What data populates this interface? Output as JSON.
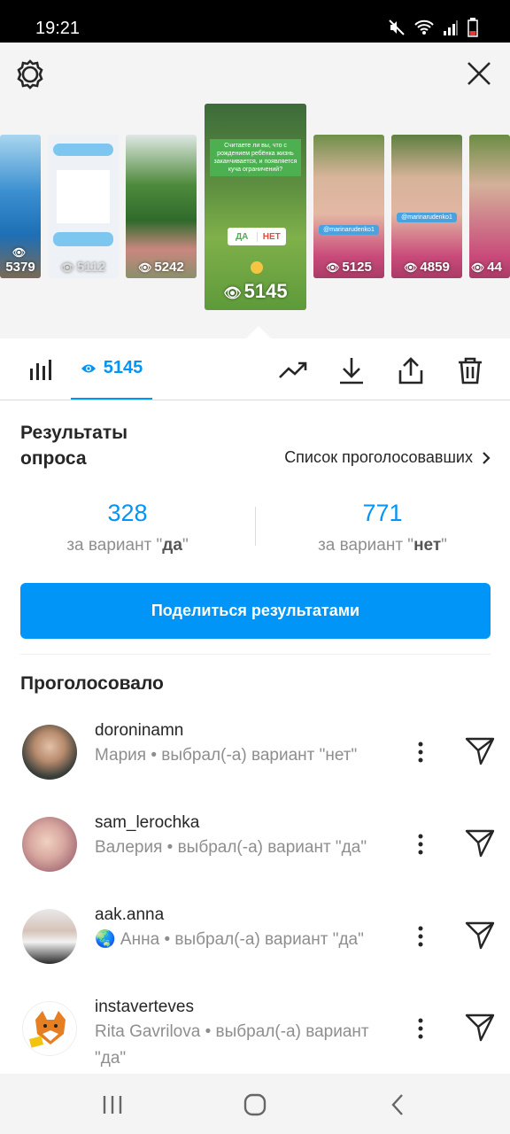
{
  "status_bar": {
    "time": "19:21",
    "icons": [
      "mute-icon",
      "wifi-icon",
      "signal-icon",
      "battery-icon"
    ]
  },
  "header": {
    "settings_icon": "gear-icon",
    "close_icon": "close-icon"
  },
  "stories": [
    {
      "views": "5379"
    },
    {
      "views": "5112"
    },
    {
      "views": "5242"
    },
    {
      "views": "5145",
      "active": true,
      "caption": "Считаете ли вы, что с рождением ребёнка жизнь заканчивается, и появляется куча ограничений?",
      "poll_yes": "ДА",
      "poll_no": "НЕТ"
    },
    {
      "views": "5125",
      "tag": "@marinarudenko1"
    },
    {
      "views": "4859",
      "tag": "@marinarudenko1"
    },
    {
      "views": "44"
    }
  ],
  "tabs": {
    "insights_icon": "bar-chart-icon",
    "viewers_count": "5145",
    "actions": [
      "trending-icon",
      "download-icon",
      "share-icon",
      "trash-icon"
    ]
  },
  "results": {
    "title": "Результаты опроса",
    "voters_link": "Список проголосовавших"
  },
  "poll": {
    "yes": {
      "count": "328",
      "label_prefix": "за вариант \"",
      "option": "да",
      "label_suffix": "\""
    },
    "no": {
      "count": "771",
      "label_prefix": "за вариант \"",
      "option": "нет",
      "label_suffix": "\""
    }
  },
  "share_button": "Поделиться результатами",
  "voted_title": "Проголосовало",
  "voters": [
    {
      "username": "doroninamn",
      "detail": "Мария • выбрал(-а) вариант \"нет\""
    },
    {
      "username": "sam_lerochka",
      "detail": "Валерия • выбрал(-а) вариант \"да\""
    },
    {
      "username": "aak.anna",
      "detail": "🌏 Анна • выбрал(-а) вариант \"да\""
    },
    {
      "username": "instaverteves",
      "detail": "Rita Gavrilova • выбрал(-а) вариант \"да\""
    }
  ],
  "colors": {
    "accent": "#0095f6",
    "text": "#262626",
    "secondary": "#8e8e8e"
  }
}
